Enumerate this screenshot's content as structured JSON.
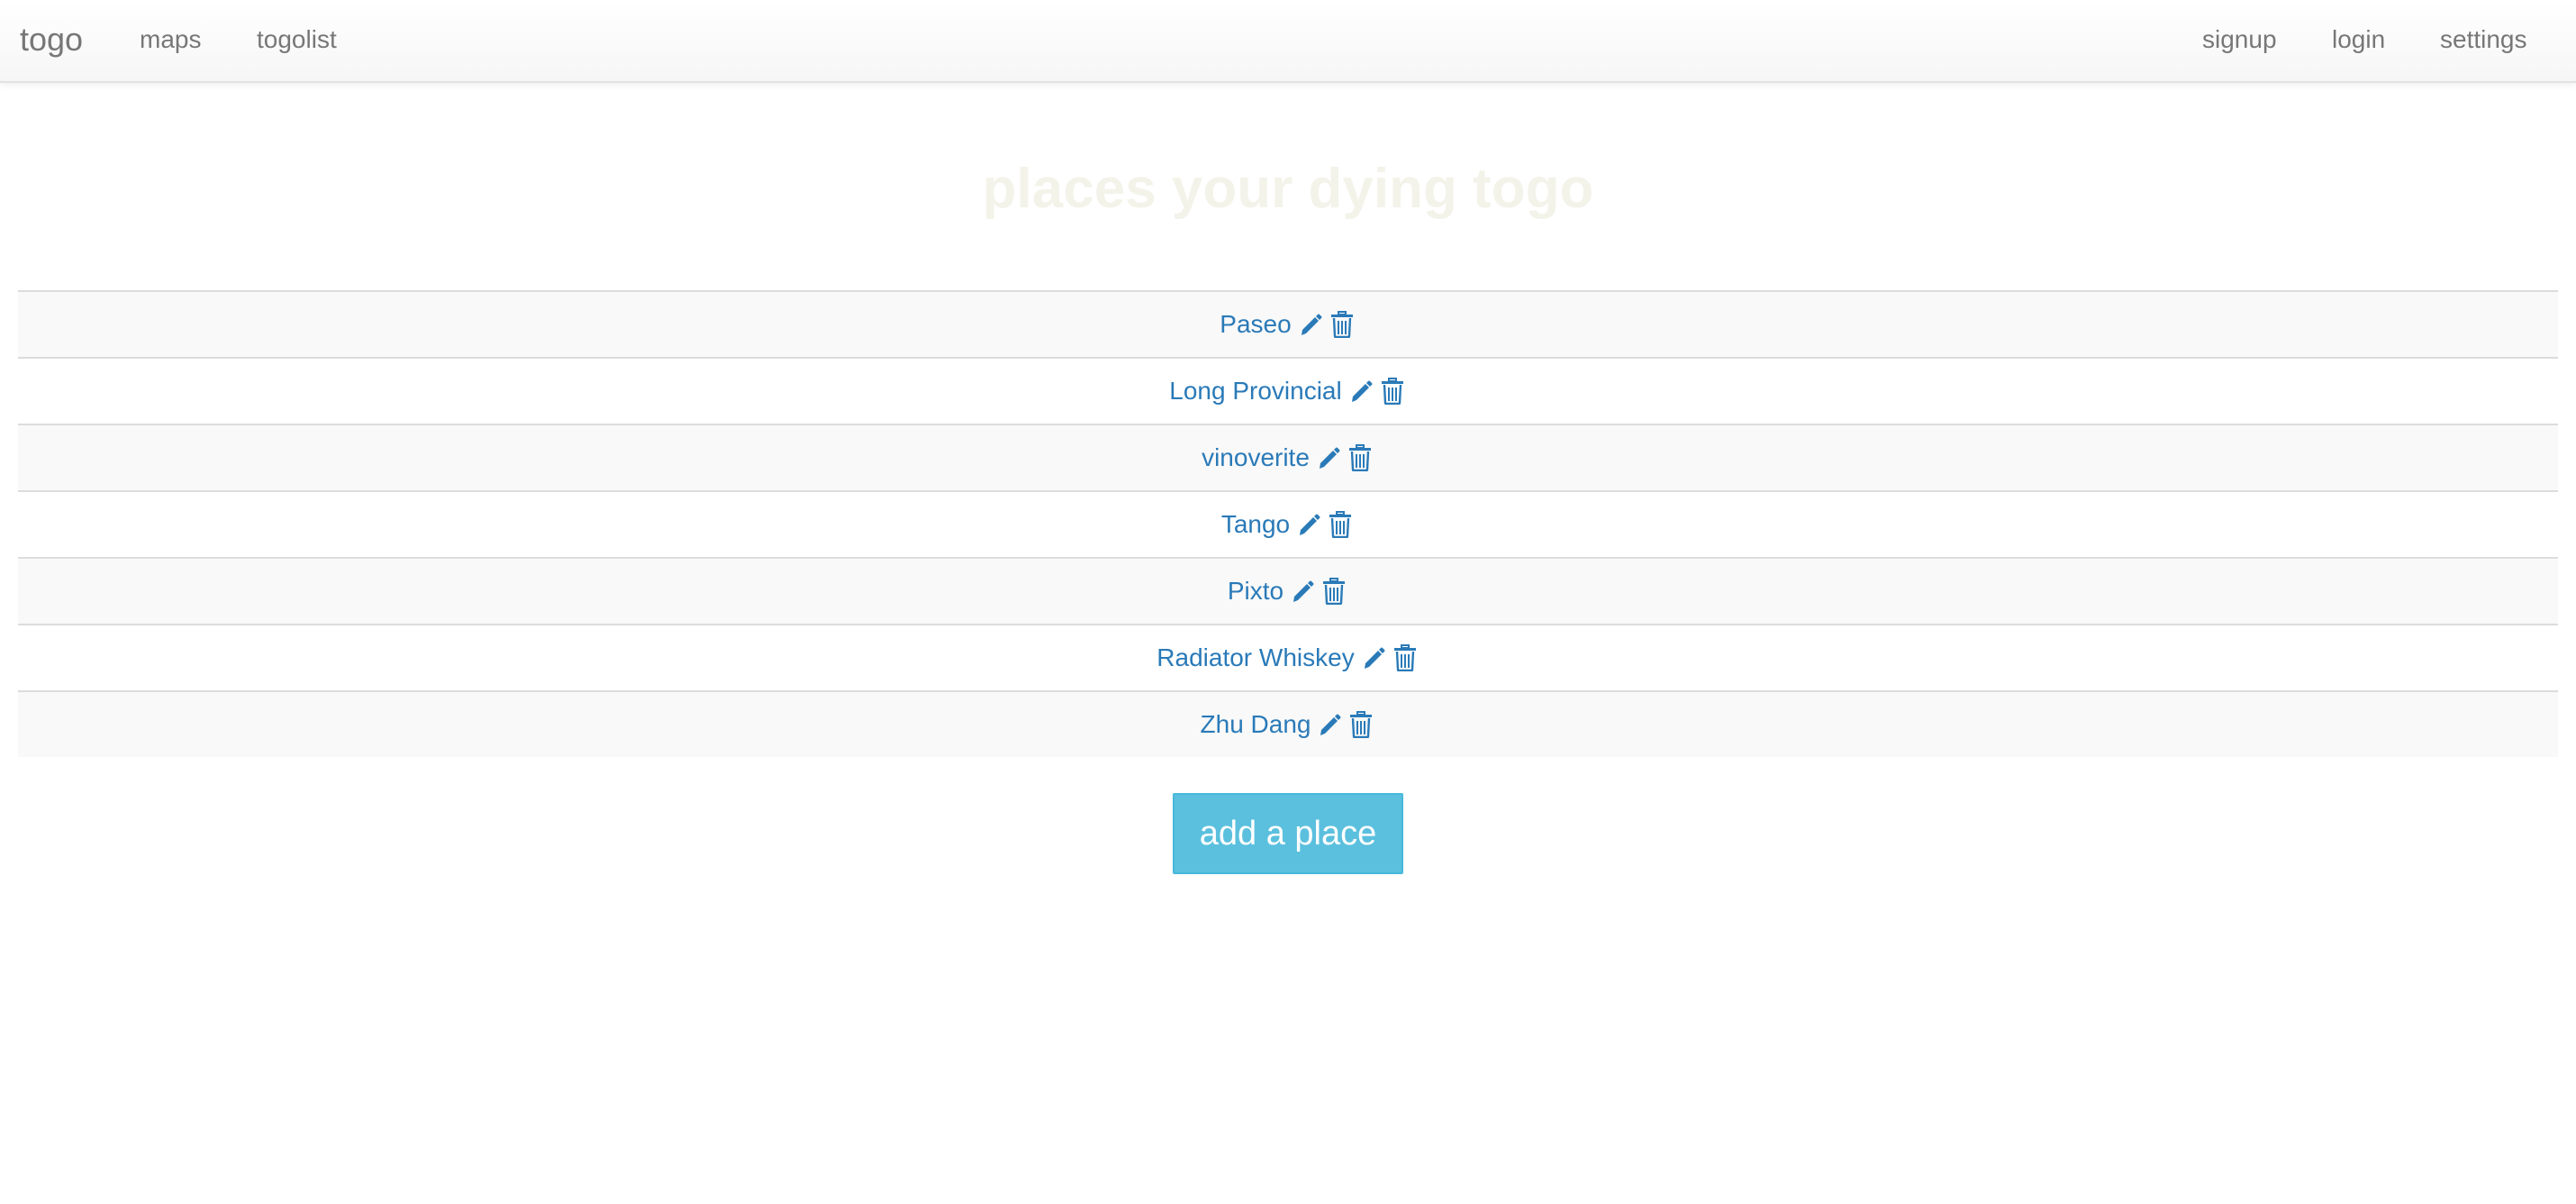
{
  "navbar": {
    "brand": "togo",
    "left_links": [
      {
        "label": "maps"
      },
      {
        "label": "togolist"
      }
    ],
    "right_links": [
      {
        "label": "signup"
      },
      {
        "label": "login"
      },
      {
        "label": "settings"
      }
    ]
  },
  "main": {
    "title": "places your dying togo",
    "places": [
      {
        "name": "Paseo",
        "edit_icon": "pencil-icon",
        "delete_icon": "trash-icon"
      },
      {
        "name": "Long Provincial",
        "edit_icon": "pencil-icon",
        "delete_icon": "trash-icon"
      },
      {
        "name": "vinoverite",
        "edit_icon": "pencil-icon",
        "delete_icon": "trash-icon"
      },
      {
        "name": "Tango",
        "edit_icon": "pencil-icon",
        "delete_icon": "trash-icon"
      },
      {
        "name": "Pixto",
        "edit_icon": "pencil-icon",
        "delete_icon": "trash-icon"
      },
      {
        "name": "Radiator Whiskey",
        "edit_icon": "pencil-icon",
        "delete_icon": "trash-icon"
      },
      {
        "name": "Zhu Dang",
        "edit_icon": "pencil-icon",
        "delete_icon": "trash-icon"
      }
    ],
    "add_button_label": "add a place"
  },
  "colors": {
    "link": "#2a7ab8",
    "nav_text": "#777777",
    "title": "#f3f3ea",
    "button_bg": "#5bc0de",
    "row_stripe": "#f9f9f9",
    "row_border": "#dcdcdc"
  }
}
